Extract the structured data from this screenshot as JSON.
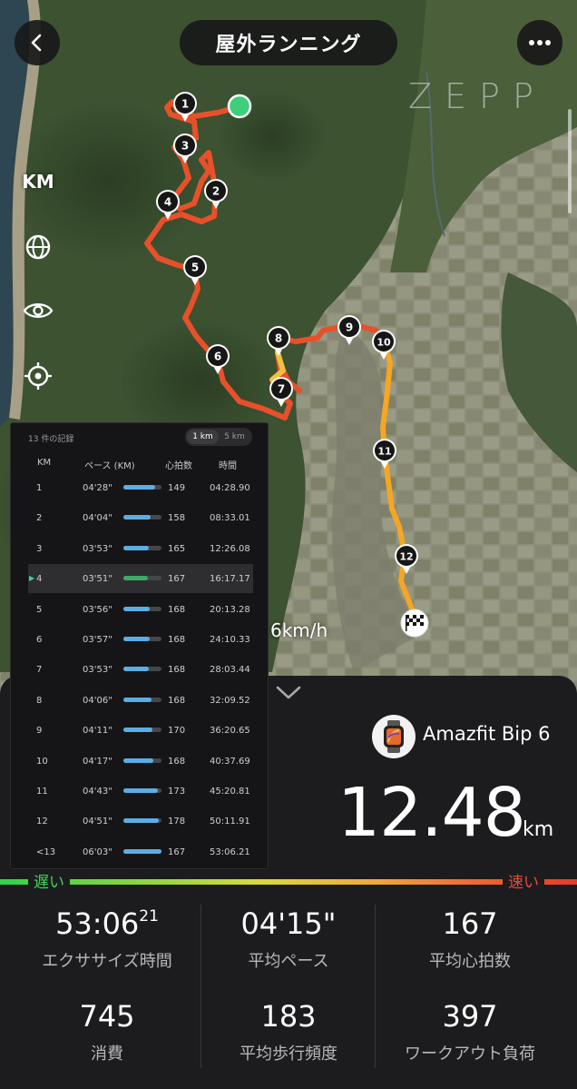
{
  "header": {
    "title": "屋外ランニング",
    "brand": "ZEPP"
  },
  "map": {
    "unit_button": "KM",
    "markers": [
      "1",
      "2",
      "3",
      "4",
      "5",
      "6",
      "7",
      "8",
      "9",
      "10",
      "11",
      "12"
    ],
    "speed_label": "6km/h"
  },
  "splits": {
    "record_count": "13 件の記録",
    "toggle": [
      "1 km",
      "5 km"
    ],
    "toggle_selected": "1 km",
    "headers": {
      "km": "KM",
      "pace": "ペース (KM)",
      "hr": "心拍数",
      "time": "時間"
    },
    "selected_index": 3,
    "rows": [
      {
        "km": "1",
        "pace": "04'28\"",
        "pace_fill": 0.84,
        "hr": "149",
        "time": "04:28.90"
      },
      {
        "km": "2",
        "pace": "04'04\"",
        "pace_fill": 0.72,
        "hr": "158",
        "time": "08:33.01"
      },
      {
        "km": "3",
        "pace": "03'53\"",
        "pace_fill": 0.66,
        "hr": "165",
        "time": "12:26.08"
      },
      {
        "km": "4",
        "pace": "03'51\"",
        "pace_fill": 0.65,
        "hr": "167",
        "time": "16:17.17"
      },
      {
        "km": "5",
        "pace": "03'56\"",
        "pace_fill": 0.68,
        "hr": "168",
        "time": "20:13.28"
      },
      {
        "km": "6",
        "pace": "03'57\"",
        "pace_fill": 0.68,
        "hr": "168",
        "time": "24:10.33"
      },
      {
        "km": "7",
        "pace": "03'53\"",
        "pace_fill": 0.66,
        "hr": "168",
        "time": "28:03.44"
      },
      {
        "km": "8",
        "pace": "04'06\"",
        "pace_fill": 0.73,
        "hr": "168",
        "time": "32:09.52"
      },
      {
        "km": "9",
        "pace": "04'11\"",
        "pace_fill": 0.76,
        "hr": "170",
        "time": "36:20.65"
      },
      {
        "km": "10",
        "pace": "04'17\"",
        "pace_fill": 0.79,
        "hr": "168",
        "time": "40:37.69"
      },
      {
        "km": "11",
        "pace": "04'43\"",
        "pace_fill": 0.9,
        "hr": "173",
        "time": "45:20.81"
      },
      {
        "km": "12",
        "pace": "04'51\"",
        "pace_fill": 0.93,
        "hr": "178",
        "time": "50:11.91"
      },
      {
        "km": "<13",
        "pace": "06'03\"",
        "pace_fill": 1.0,
        "hr": "167",
        "time": "53:06.21"
      }
    ]
  },
  "summary": {
    "device_name": "Amazfit Bip 6",
    "distance": "12.48",
    "distance_unit": "km",
    "slow_label": "遅い",
    "fast_label": "速い",
    "stats": [
      {
        "value": "53:06",
        "value_sup": "21",
        "label": "エクササイズ時間"
      },
      {
        "value": "04'15\"",
        "label": "平均ペース"
      },
      {
        "value": "167",
        "label": "平均心拍数"
      },
      {
        "value": "745",
        "label": "消費"
      },
      {
        "value": "183",
        "label": "平均歩行頻度"
      },
      {
        "value": "397",
        "label": "ワークアウト負荷"
      }
    ]
  },
  "colors": {
    "route_fast": "#e8502a",
    "route_slow": "#f5a623",
    "start_marker": "#3ecf7a",
    "bar_default": "#5aaee5",
    "bar_selected": "#3fa86a",
    "slow": "#3fd25a",
    "fast": "#ea4a3a"
  },
  "icons": {
    "back": "chevron-left-icon",
    "more": "more-dots-icon",
    "globe": "globe-icon",
    "eye": "eye-icon",
    "locate": "locate-icon",
    "collapse": "chevron-down-icon",
    "finish": "checkered-flag-icon",
    "watch": "watch-icon"
  }
}
